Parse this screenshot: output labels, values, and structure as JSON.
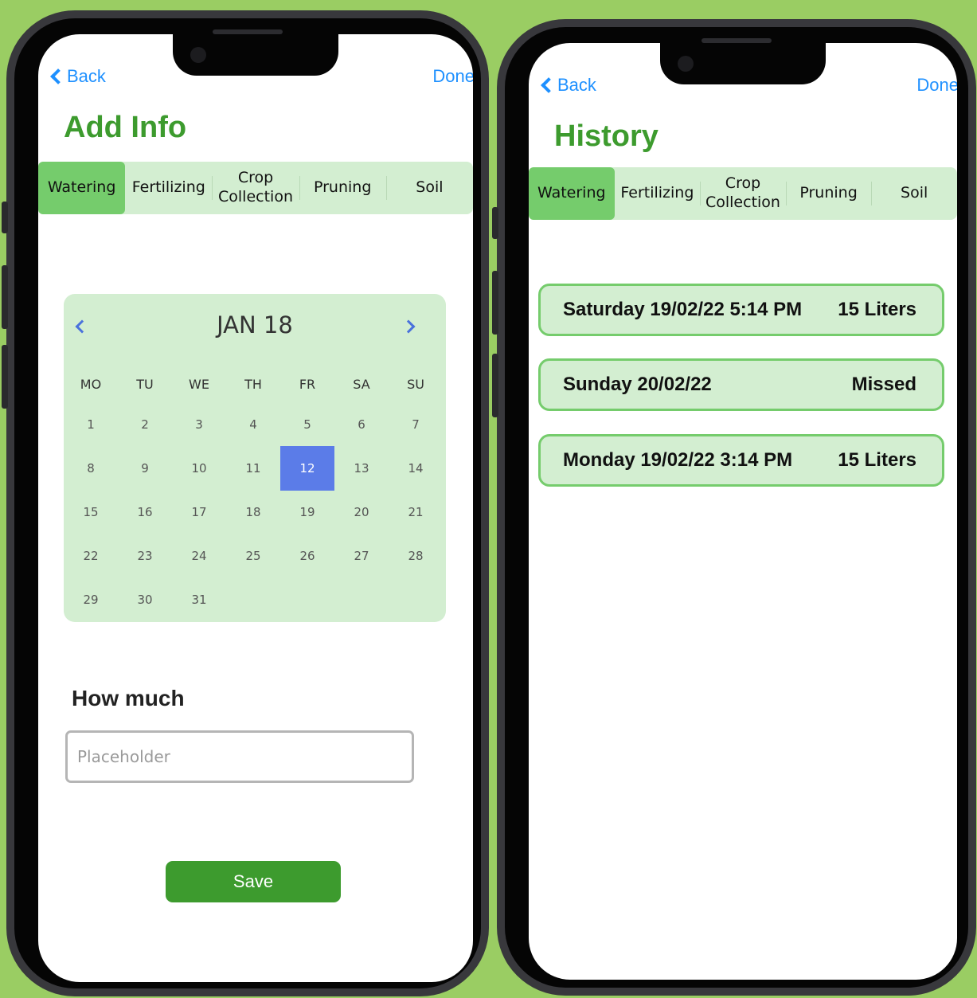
{
  "nav": {
    "back_label": "Back",
    "done_label": "Done"
  },
  "add_info": {
    "title": "Add Info",
    "tabs": [
      {
        "label": "Watering",
        "active": true
      },
      {
        "label": "Fertilizing",
        "active": false
      },
      {
        "label": "Crop\nCollection",
        "active": false
      },
      {
        "label": "Pruning",
        "active": false
      },
      {
        "label": "Soil",
        "active": false
      }
    ],
    "calendar": {
      "month_label": "JAN 18",
      "weekdays": [
        "MO",
        "TU",
        "WE",
        "TH",
        "FR",
        "SA",
        "SU"
      ],
      "days": [
        "1",
        "2",
        "3",
        "4",
        "5",
        "6",
        "7",
        "8",
        "9",
        "10",
        "11",
        "12",
        "13",
        "14",
        "15",
        "16",
        "17",
        "18",
        "19",
        "20",
        "21",
        "22",
        "23",
        "24",
        "25",
        "26",
        "27",
        "28",
        "29",
        "30",
        "31"
      ],
      "selected_day": "12",
      "first_weekday_index": 0
    },
    "how_much_label": "How much",
    "amount_placeholder": "Placeholder",
    "amount_value": "",
    "save_label": "Save"
  },
  "history": {
    "title": "History",
    "tabs": [
      {
        "label": "Watering",
        "active": true
      },
      {
        "label": "Fertilizing",
        "active": false
      },
      {
        "label": "Crop\nCollection",
        "active": false
      },
      {
        "label": "Pruning",
        "active": false
      },
      {
        "label": "Soil",
        "active": false
      }
    ],
    "entries": [
      {
        "date": "Saturday 19/02/22 5:14 PM",
        "amount": "15 Liters"
      },
      {
        "date": "Sunday 20/02/22",
        "amount": "Missed"
      },
      {
        "date": "Monday 19/02/22 3:14 PM",
        "amount": "15 Liters"
      }
    ]
  },
  "colors": {
    "background": "#9acd63",
    "brand_green": "#3d9b2e",
    "tab_bar": "#d3eed1",
    "tab_active": "#75cc6c",
    "calendar_selected": "#5b7ce8",
    "link_blue": "#1e90ff"
  }
}
